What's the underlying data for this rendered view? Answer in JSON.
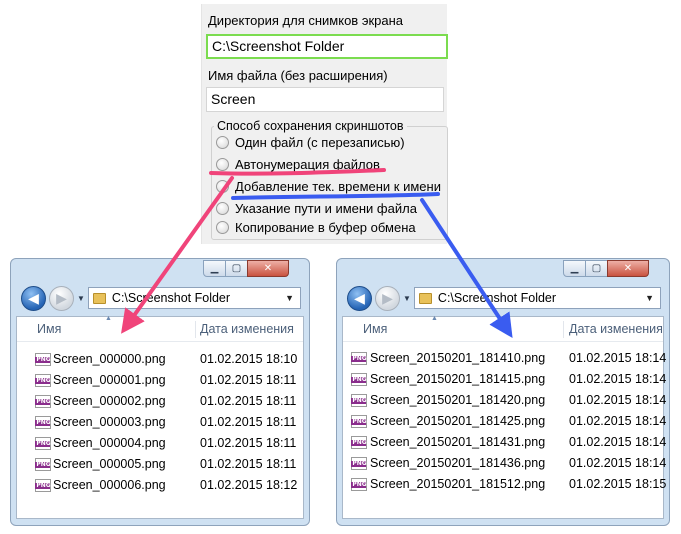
{
  "settings": {
    "dir_label": "Директория для снимков экрана",
    "dir_value": "C:\\Screenshot Folder",
    "name_label": "Имя файла (без расширения)",
    "name_value": "Screen",
    "group_title": "Способ сохранения скриншотов",
    "options": [
      "Один файл (с перезаписью)",
      "Автонумерация файлов",
      "Добавление тек. времени к имени",
      "Указание пути и имени файла",
      "Копирование в буфер обмена"
    ]
  },
  "annotation_colors": {
    "autonumber": "#f0447a",
    "timestamp": "#3a5cf0"
  },
  "explorer_left": {
    "address": "C:\\Screenshot Folder",
    "col_name": "Имя",
    "col_date": "Дата изменения",
    "icon_badge": "PNG",
    "files": [
      {
        "name": "Screen_000000.png",
        "date": "01.02.2015 18:10"
      },
      {
        "name": "Screen_000001.png",
        "date": "01.02.2015 18:11"
      },
      {
        "name": "Screen_000002.png",
        "date": "01.02.2015 18:11"
      },
      {
        "name": "Screen_000003.png",
        "date": "01.02.2015 18:11"
      },
      {
        "name": "Screen_000004.png",
        "date": "01.02.2015 18:11"
      },
      {
        "name": "Screen_000005.png",
        "date": "01.02.2015 18:11"
      },
      {
        "name": "Screen_000006.png",
        "date": "01.02.2015 18:12"
      }
    ]
  },
  "explorer_right": {
    "address": "C:\\Screenshot Folder",
    "col_name": "Имя",
    "col_date": "Дата изменения",
    "icon_badge": "PNG",
    "files": [
      {
        "name": "Screen_20150201_181410.png",
        "date": "01.02.2015 18:14"
      },
      {
        "name": "Screen_20150201_181415.png",
        "date": "01.02.2015 18:14"
      },
      {
        "name": "Screen_20150201_181420.png",
        "date": "01.02.2015 18:14"
      },
      {
        "name": "Screen_20150201_181425.png",
        "date": "01.02.2015 18:14"
      },
      {
        "name": "Screen_20150201_181431.png",
        "date": "01.02.2015 18:14"
      },
      {
        "name": "Screen_20150201_181436.png",
        "date": "01.02.2015 18:14"
      },
      {
        "name": "Screen_20150201_181512.png",
        "date": "01.02.2015 18:15"
      }
    ]
  }
}
